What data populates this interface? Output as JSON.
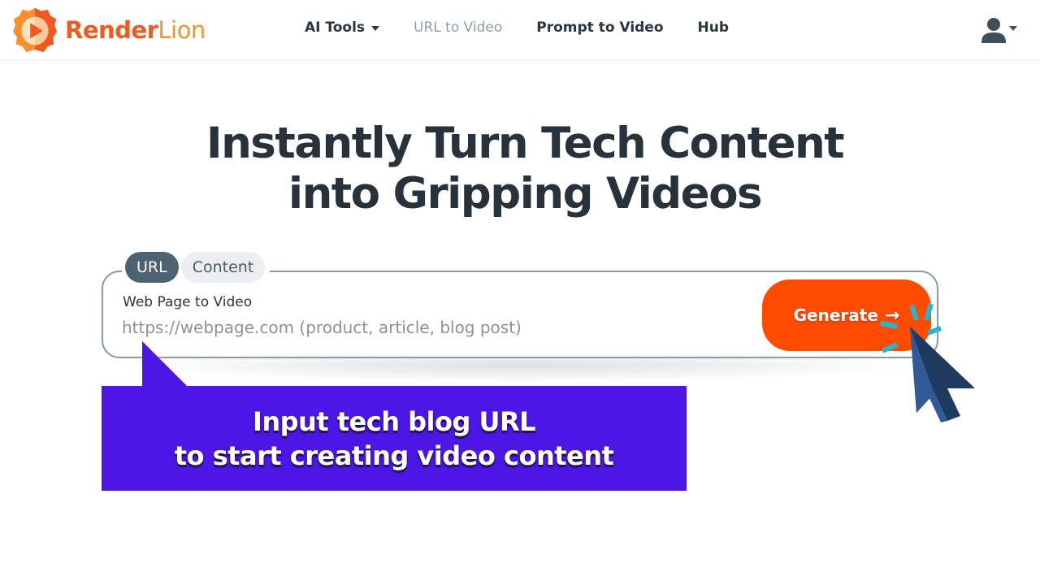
{
  "brand": {
    "name_part1": "Render",
    "name_part2": "Lion",
    "primary_color": "#f15a1e",
    "secondary_color": "#f7902f"
  },
  "nav": {
    "items": [
      {
        "label": "AI Tools",
        "has_dropdown": true,
        "active": false
      },
      {
        "label": "URL to Video",
        "has_dropdown": false,
        "active": true
      },
      {
        "label": "Prompt to Video",
        "has_dropdown": false,
        "active": false
      },
      {
        "label": "Hub",
        "has_dropdown": false,
        "active": false
      }
    ],
    "user_menu_icon": "user-icon"
  },
  "hero": {
    "title_line1": "Instantly Turn Tech Content",
    "title_line2": "into Gripping Videos"
  },
  "input_card": {
    "tabs": [
      {
        "label": "URL",
        "selected": true
      },
      {
        "label": "Content",
        "selected": false
      }
    ],
    "field_label": "Web Page to Video",
    "field_value": "",
    "field_placeholder": "https://webpage.com (product, article, blog post)",
    "generate_label": "Generate",
    "generate_icon": "arrow-right-icon",
    "generate_color": "#ff4b00"
  },
  "callout": {
    "line1": "Input tech blog URL",
    "line2": "to start creating video content",
    "color": "#4c17e6"
  }
}
